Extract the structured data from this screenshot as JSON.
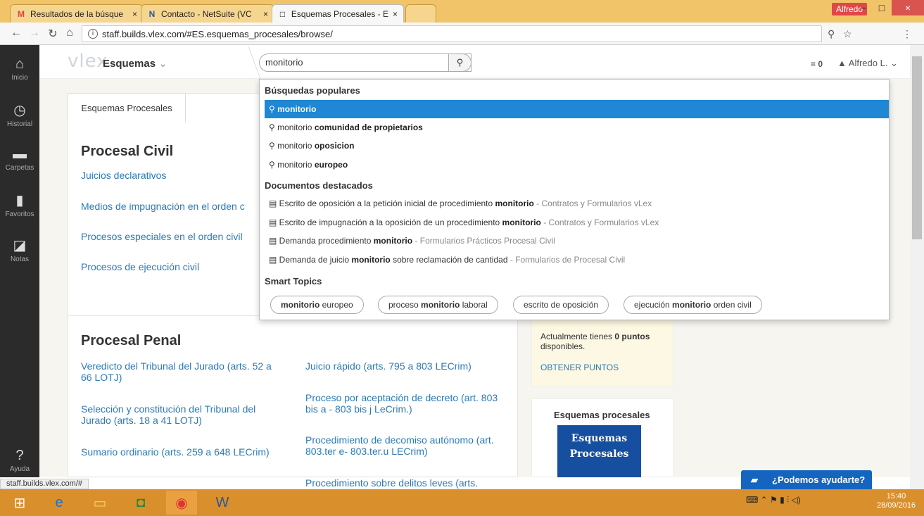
{
  "browser": {
    "tabs": [
      {
        "icon": "M",
        "title": "Resultados de la búsque",
        "close": "×"
      },
      {
        "icon": "N",
        "title": "Contacto - NetSuite (VC",
        "close": "×"
      },
      {
        "icon": "□",
        "title": "Esquemas Procesales - E",
        "close": "×"
      }
    ],
    "profile": "Alfredo",
    "window": {
      "minimize": "−",
      "maximize": "□",
      "close": "×"
    },
    "url": "staff.builds.vlex.com/#ES.esquemas_procesales/browse/",
    "status_url": "staff.builds.vlex.com/#"
  },
  "sidebar": {
    "items": [
      {
        "label": "Inicio",
        "icon": "home-icon"
      },
      {
        "label": "Historial",
        "icon": "history-icon"
      },
      {
        "label": "Carpetas",
        "icon": "folder-icon"
      },
      {
        "label": "Favoritos",
        "icon": "bookmark-icon"
      },
      {
        "label": "Notas",
        "icon": "note-icon"
      },
      {
        "label": "Ayuda",
        "icon": "help-icon"
      }
    ]
  },
  "header": {
    "logo": "vlex",
    "section": "Esquemas",
    "search_value": "monitorio",
    "notifications": "0",
    "user": "Alfredo L."
  },
  "content": {
    "tab": "Esquemas Procesales",
    "civil_title": "Procesal Civil",
    "civil_links": [
      "Juicios declarativos",
      "Medios de impugnación en el orden c",
      "Procesos especiales en el orden civil",
      "Procesos de ejecución civil"
    ],
    "penal_title": "Procesal Penal",
    "penal_left": [
      "Veredicto del Tribunal del Jurado (arts. 52 a 66 LOTJ)",
      "Selección y constitución del Tribunal del Jurado (arts. 18 a 41 LOTJ)",
      "Sumario ordinario (arts. 259 a 648 LECrim)"
    ],
    "penal_right": [
      "Juicio rápido (arts. 795 a 803 LECrim)",
      "Proceso por aceptación de decreto (art. 803 bis a - 803 bis j LeCrim.)",
      "Procedimiento de decomiso autónomo (art. 803.ter e- 803.ter.u LECrim)",
      "Procedimiento sobre delitos leves (arts."
    ],
    "points_text_pre": "Actualmente tienes ",
    "points_bold": "0 puntos",
    "points_text_post": " disponibles.",
    "points_link": "OBTENER PUNTOS",
    "esq_card_title": "Esquemas procesales",
    "esq_img_line1": "Esquemas",
    "esq_img_line2": "Procesales"
  },
  "dropdown": {
    "popular_title": "Búsquedas populares",
    "popular": [
      {
        "pre": "monitorio",
        "bold": ""
      },
      {
        "pre": "monitorio ",
        "bold": "comunidad de propietarios"
      },
      {
        "pre": "monitorio ",
        "bold": "oposicion"
      },
      {
        "pre": "monitorio ",
        "bold": "europeo"
      }
    ],
    "docs_title": "Documentos destacados",
    "docs": [
      {
        "pre": "Escrito de oposición a la petición inicial de procedimiento ",
        "bold": "monitorio",
        "src": " - Contratos y Formularios vLex"
      },
      {
        "pre": "Escrito de impugnación a la oposición de un procedimiento ",
        "bold": "monitorio",
        "src": " - Contratos y Formularios vLex"
      },
      {
        "pre": "Demanda procedimiento ",
        "bold": "monitorio",
        "src": " - Formularios Prácticos Procesal Civil"
      },
      {
        "pre": "Demanda de juicio ",
        "bold": "monitorio",
        "post": " sobre reclamación de cantidad",
        "src": " - Formularios de Procesal Civil"
      }
    ],
    "topics_title": "Smart Topics",
    "topics": [
      {
        "pre": "",
        "bold": "monitorio",
        "post": " europeo"
      },
      {
        "pre": "proceso ",
        "bold": "monitorio",
        "post": " laboral"
      },
      {
        "pre": "escrito de oposición",
        "bold": "",
        "post": ""
      },
      {
        "pre": "ejecución ",
        "bold": "monitorio",
        "post": " orden civil"
      }
    ]
  },
  "chat": "¿Podemos ayudarte?",
  "taskbar": {
    "time": "15:40",
    "date": "28/09/2016"
  },
  "colors": {
    "accent": "#1f87d4",
    "taskbar": "#d98f2b",
    "sidebar": "#2b2b2b"
  }
}
